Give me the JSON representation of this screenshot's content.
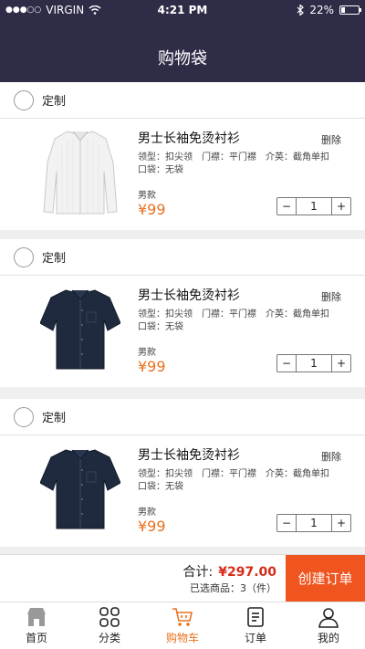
{
  "status_bar": {
    "carrier": "VIRGIN",
    "time": "4:21 PM",
    "battery": "22%",
    "battery_level": 0.22
  },
  "header": {
    "title": "购物袋"
  },
  "cart": {
    "items": [
      {
        "group_label": "定制",
        "name": "男士长袖免烫衬衫",
        "delete_label": "删除",
        "spec": "领型：扣尖领　门襟：平门襟　介英：截角单扣　口袋：无袋",
        "gender": "男款",
        "price": "¥99",
        "quantity": "1",
        "image": "white-long-sleeve-shirt"
      },
      {
        "group_label": "定制",
        "name": "男士长袖免烫衬衫",
        "delete_label": "删除",
        "spec": "领型：扣尖领　门襟：平门襟　介英：截角单扣　口袋：无袋",
        "gender": "男款",
        "price": "¥99",
        "quantity": "1",
        "image": "navy-short-sleeve-shirt"
      },
      {
        "group_label": "定制",
        "name": "男士长袖免烫衬衫",
        "delete_label": "删除",
        "spec": "领型：扣尖领　门襟：平门襟　介英：截角单扣　口袋：无袋",
        "gender": "男款",
        "price": "¥99",
        "quantity": "1",
        "image": "navy-short-sleeve-shirt"
      }
    ]
  },
  "stepper": {
    "minus": "−",
    "plus": "+"
  },
  "checkout": {
    "total_label": "合计:",
    "total_amount": "¥297.00",
    "selected_text": "已选商品：3（件）",
    "create_order_label": "创建订单"
  },
  "tabbar": {
    "items": [
      {
        "label": "首页",
        "icon": "store-icon"
      },
      {
        "label": "分类",
        "icon": "grid-icon"
      },
      {
        "label": "购物车",
        "icon": "cart-icon"
      },
      {
        "label": "订单",
        "icon": "order-icon"
      },
      {
        "label": "我的",
        "icon": "user-icon"
      }
    ],
    "active_index": 2
  },
  "colors": {
    "header_bg": "#2f2c48",
    "accent": "#e8711f",
    "button": "#f0541f",
    "price_total": "#d62c1a"
  }
}
